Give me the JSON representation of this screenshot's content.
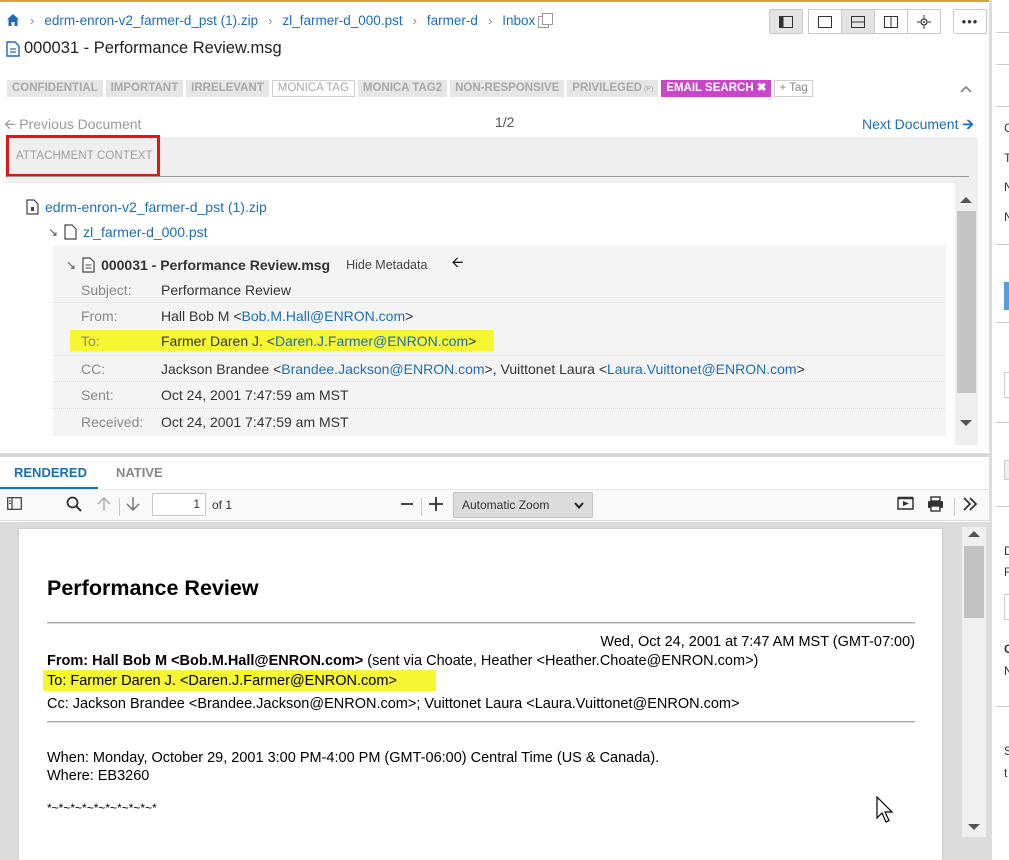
{
  "breadcrumb": {
    "items": [
      "edrm-enron-v2_farmer-d_pst (1).zip",
      "zl_farmer-d_000.pst",
      "farmer-d",
      "Inbox"
    ]
  },
  "document": {
    "title": "000031 - Performance Review.msg"
  },
  "tags": [
    {
      "label": "CONFIDENTIAL",
      "style": "filled"
    },
    {
      "label": "IMPORTANT",
      "style": "filled"
    },
    {
      "label": "IRRELEVANT",
      "style": "filled"
    },
    {
      "label": "MONICA TAG",
      "style": "outline"
    },
    {
      "label": "MONICA TAG2",
      "style": "filled"
    },
    {
      "label": "NON-RESPONSIVE",
      "style": "filled"
    },
    {
      "label": "PRIVILEGED",
      "style": "filled",
      "sub": "(P)"
    },
    {
      "label": "EMAIL SEARCH",
      "style": "email"
    }
  ],
  "add_tag_label": "Tag",
  "nav": {
    "prev": "Previous Document",
    "count": "1/2",
    "next": "Next Document"
  },
  "context": {
    "label": "ATTACHMENT CONTEXT",
    "zip": "edrm-enron-v2_farmer-d_pst (1).zip",
    "pst": "zl_farmer-d_000.pst",
    "msg": "000031 - Performance Review.msg",
    "hide_metadata": "Hide Metadata"
  },
  "metadata": {
    "subject_label": "Subject:",
    "subject": "Performance Review",
    "from_label": "From:",
    "from_name": "Hall Bob M <",
    "from_email": "Bob.M.Hall@ENRON.com",
    "from_end": ">",
    "to_label": "To:",
    "to_name": "Farmer Daren J. <",
    "to_email": "Daren.J.Farmer@ENRON.com",
    "to_end": ">",
    "cc_label": "CC:",
    "cc1_name": "Jackson Brandee <",
    "cc1_email": "Brandee.Jackson@ENRON.com",
    "cc1_end": ">, Vuittonet Laura <",
    "cc2_email": "Laura.Vuittonet@ENRON.com",
    "cc2_end": ">",
    "sent_label": "Sent:",
    "sent": "Oct 24, 2001 7:47:59 am MST",
    "received_label": "Received:",
    "received": "Oct 24, 2001 7:47:59 am MST"
  },
  "viewer": {
    "tabs": [
      "RENDERED",
      "NATIVE"
    ],
    "page": "1",
    "of": "of 1",
    "zoom": "Automatic Zoom"
  },
  "pdf": {
    "title": "Performance Review",
    "date": "Wed, Oct 24, 2001 at 7:47 AM MST (GMT-07:00)",
    "from_bold": "From: Hall Bob M <Bob.M.Hall@ENRON.com>",
    "from_rest": " (sent via Choate, Heather <Heather.Choate@ENRON.com>)",
    "to": "To: Farmer Daren J. <Daren.J.Farmer@ENRON.com>",
    "cc": "Cc: Jackson Brandee <Brandee.Jackson@ENRON.com>; Vuittonet Laura <Laura.Vuittonet@ENRON.com>",
    "when": "When: Monday, October 29, 2001 3:00 PM-4:00 PM (GMT-06:00) Central Time (US & Canada).",
    "where": "Where: EB3260",
    "stars": "*~*~*~*~*~*~*~*~*~*"
  },
  "right_panel": {
    "chars": [
      "C",
      "T",
      "N",
      "N",
      "D",
      "F",
      "C",
      "N",
      "S",
      "t"
    ]
  },
  "colors": {
    "accent": "#1e6cb6",
    "highlight": "#f6f632",
    "email_tag": "#cc44cc",
    "red_box": "#e81313"
  }
}
